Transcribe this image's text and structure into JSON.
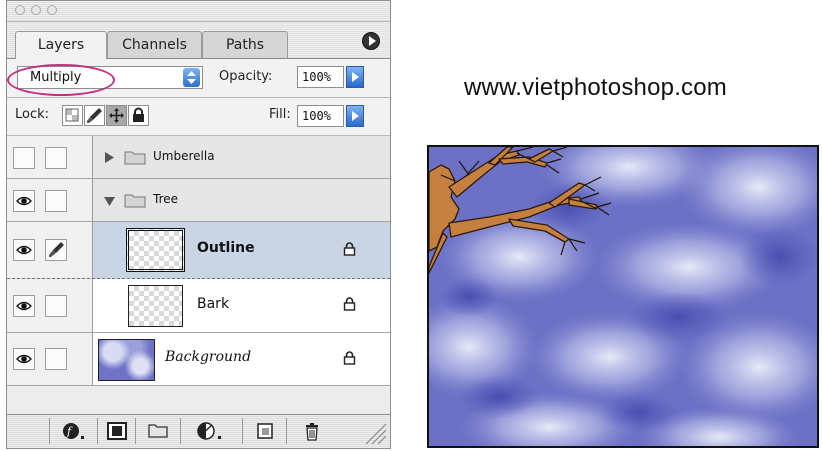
{
  "palette": {
    "tabs": [
      {
        "label": "Layers"
      },
      {
        "label": "Channels"
      },
      {
        "label": "Paths"
      }
    ],
    "blend_mode": "Multiply",
    "opacity_label": "Opacity:",
    "opacity_value": "100%",
    "lock_label": "Lock:",
    "fill_label": "Fill:",
    "fill_value": "100%",
    "layers": [
      {
        "name": "Umberella",
        "type": "group",
        "visible": false,
        "expanded": false
      },
      {
        "name": "Tree",
        "type": "group",
        "visible": true,
        "expanded": true
      },
      {
        "name": "Outline",
        "type": "layer",
        "visible": true,
        "selected": true,
        "locked": true
      },
      {
        "name": "Bark",
        "type": "layer",
        "visible": true,
        "locked": true
      },
      {
        "name": "Background",
        "type": "background",
        "visible": true,
        "locked": true
      }
    ]
  },
  "website": "www.vietphotoshop.com",
  "colors": {
    "highlight_ring": "#c2307f",
    "selected_row": "#c9d5e4",
    "aqua_blue": "#2f6fd0",
    "branch": "#c57f3f",
    "sky": "#6a6fc6"
  }
}
